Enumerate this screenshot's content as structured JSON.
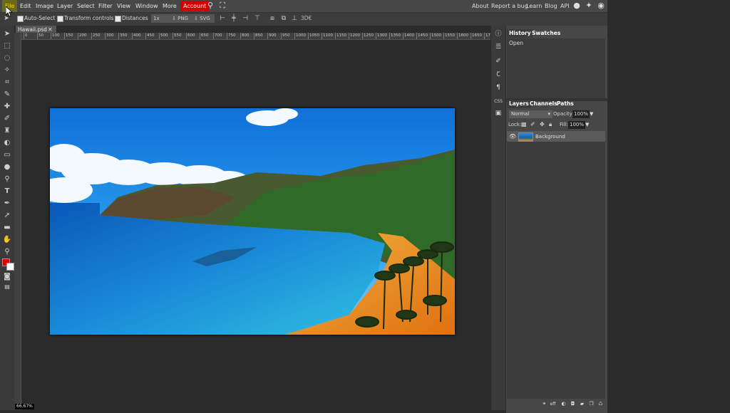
{
  "menubar": {
    "items": [
      "File",
      "Edit",
      "Image",
      "Layer",
      "Select",
      "Filter",
      "View",
      "Window",
      "More"
    ],
    "account": "Account",
    "right_links": [
      "About",
      "Report a bug",
      "Learn",
      "Blog",
      "API"
    ]
  },
  "options": {
    "auto_select": "Auto-Select",
    "transform_controls": "Transform controls",
    "distances": "Distances",
    "scale": "1x",
    "png": "PNG",
    "svg": "SVG",
    "threed": "3D€"
  },
  "document": {
    "tab_name": "Hawaii.psd",
    "zoom": "66.67%"
  },
  "ruler": {
    "ticks": [
      "0",
      "50",
      "100",
      "150",
      "200",
      "250",
      "300",
      "350",
      "400",
      "450",
      "500",
      "550",
      "600",
      "650",
      "700",
      "750",
      "800",
      "850",
      "900",
      "950",
      "1000",
      "1050",
      "1100",
      "1150",
      "1200",
      "1250",
      "1300",
      "1350",
      "1400",
      "1450",
      "1500",
      "1550",
      "1600",
      "1650",
      "170"
    ]
  },
  "history_panel": {
    "tabs": [
      "History",
      "Swatches"
    ],
    "entries": [
      "Open"
    ]
  },
  "layers_panel": {
    "tabs": [
      "Layers",
      "Channels",
      "Paths"
    ],
    "blend_mode": "Normal",
    "opacity_label": "Opacity:",
    "opacity_value": "100%",
    "lock_label": "Lock:",
    "fill_label": "Fill:",
    "fill_value": "100%",
    "layers": [
      {
        "name": "Background"
      }
    ],
    "footer_text": "eff"
  },
  "right_icons": [
    "info-icon",
    "properties-icon",
    "brush-icon",
    "character-icon",
    "paragraph-icon",
    "css-icon",
    "image-icon"
  ],
  "right_icon_text": {
    "css": "CSS"
  },
  "colors": {
    "account": "#d00000",
    "file_active": "#ffd000",
    "foreground": "#e00000",
    "background": "#ffffff"
  }
}
